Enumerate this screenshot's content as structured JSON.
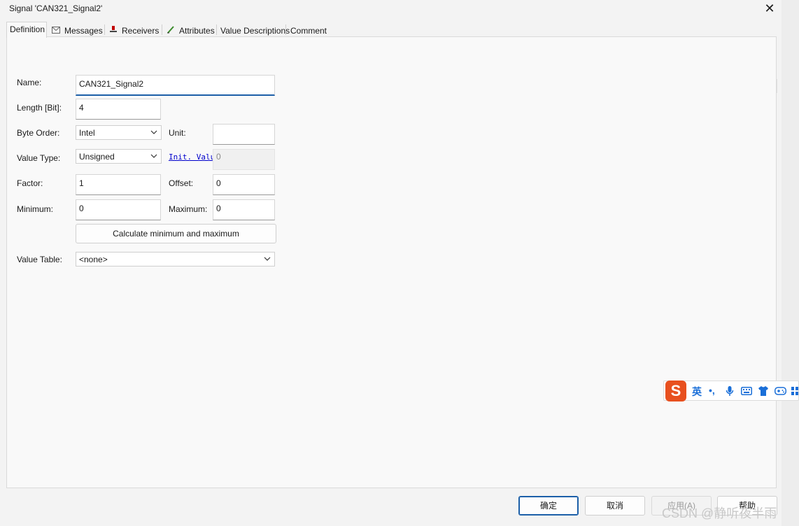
{
  "window": {
    "title": "Signal 'CAN321_Signal2'"
  },
  "tabs": [
    {
      "label": "Definition",
      "icon": "",
      "active": true
    },
    {
      "label": "Messages",
      "icon": "envelope-icon"
    },
    {
      "label": "Receivers",
      "icon": "receiver-icon"
    },
    {
      "label": "Attributes",
      "icon": "pen-icon"
    },
    {
      "label": "Value Descriptions",
      "icon": ""
    },
    {
      "label": "Comment",
      "icon": ""
    }
  ],
  "form": {
    "name_label": "Name:",
    "name_value": "CAN321_Signal2",
    "length_label": "Length [Bit]:",
    "length_value": "4",
    "byte_order_label": "Byte Order:",
    "byte_order_value": "Intel",
    "unit_label": "Unit:",
    "unit_value": "",
    "value_type_label": "Value Type:",
    "value_type_value": "Unsigned",
    "init_value_link": "Init. Value",
    "init_value": "0",
    "factor_label": "Factor:",
    "factor_value": "1",
    "offset_label": "Offset:",
    "offset_value": "0",
    "minimum_label": "Minimum:",
    "minimum_value": "0",
    "maximum_label": "Maximum:",
    "maximum_value": "0",
    "calc_button": "Calculate minimum and maximum",
    "value_table_label": "Value Table:",
    "value_table_value": "<none>"
  },
  "buttons": {
    "ok": "确定",
    "cancel": "取消",
    "apply": "应用(A)",
    "help": "帮助"
  },
  "ime": {
    "logo": "S",
    "lang": "英",
    "punct": "•,"
  },
  "watermark": "CSDN @静听夜半雨",
  "colors": {
    "accent": "#1c5fa8",
    "link": "#0000cc",
    "ime_logo": "#e8501f",
    "ime_icons": "#1a6fd8"
  }
}
